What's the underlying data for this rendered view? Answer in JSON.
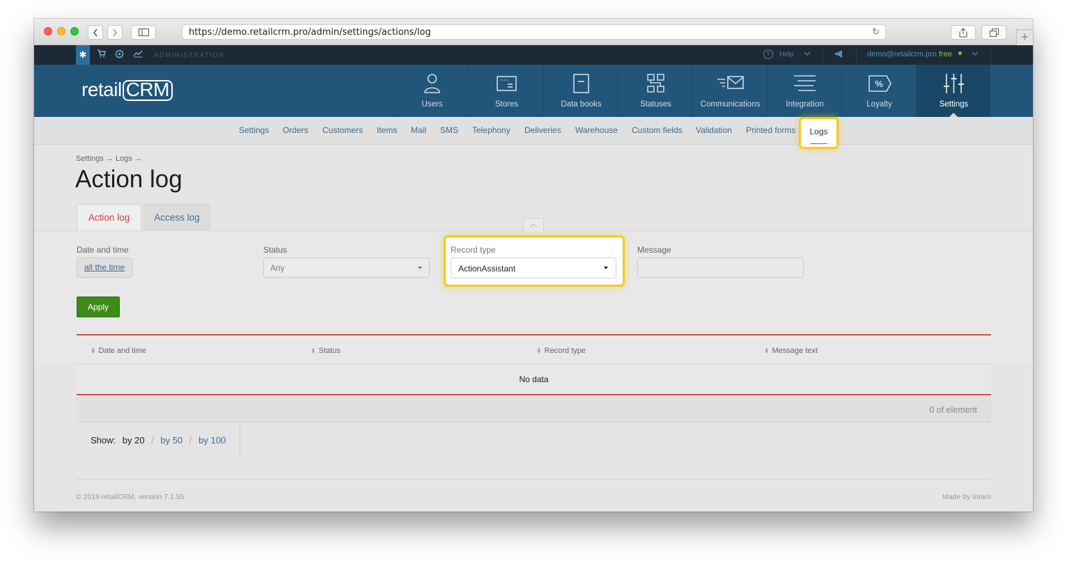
{
  "browser": {
    "url": "https://demo.retailcrm.pro/admin/settings/actions/log",
    "new_tab_glyph": "+",
    "reload_icon": "reload-icon"
  },
  "admin_bar": {
    "label": "ADMINISTRATION",
    "help": "Help",
    "email": "demo@retailcrm.pro",
    "plan": "free"
  },
  "logo": {
    "part1": "retail",
    "part2": "CRM"
  },
  "main_nav": [
    {
      "label": "Users",
      "icon": "user-icon"
    },
    {
      "label": "Stores",
      "icon": "store-icon"
    },
    {
      "label": "Data books",
      "icon": "book-icon"
    },
    {
      "label": "Statuses",
      "icon": "statuses-icon"
    },
    {
      "label": "Communications",
      "icon": "mail-icon"
    },
    {
      "label": "Integration",
      "icon": "integration-icon"
    },
    {
      "label": "Loyalty",
      "icon": "percent-tag-icon"
    },
    {
      "label": "Settings",
      "icon": "sliders-icon",
      "active": true
    }
  ],
  "sub_nav": [
    "Settings",
    "Orders",
    "Customers",
    "Items",
    "Mail",
    "SMS",
    "Telephony",
    "Deliveries",
    "Warehouse",
    "Custom fields",
    "Validation",
    "Printed forms",
    "Logs"
  ],
  "breadcrumb": "Settings → Logs →",
  "page_title": "Action log",
  "tabs": [
    "Action log",
    "Access log"
  ],
  "filters": {
    "date_label": "Date and time",
    "date_value": "all the time",
    "status_label": "Status",
    "status_value": "Any",
    "record_type_label": "Record type",
    "record_type_value": "ActionAssistant",
    "message_label": "Message",
    "message_value": "",
    "apply": "Apply"
  },
  "table": {
    "columns": [
      "Date and time",
      "Status",
      "Record type",
      "Message text"
    ],
    "empty_text": "No data"
  },
  "pagination": {
    "count_text": "0 of element",
    "show_label": "Show:",
    "options": [
      "by 20",
      "by 50",
      "by 100"
    ],
    "separator": "/"
  },
  "footer": {
    "copyright": "© 2019 retailCRM, version 7.1.55",
    "made_by": "Made by Intaro"
  },
  "colors": {
    "nav_bg": "#22557a",
    "highlight": "#f3cb1c",
    "apply_green": "#3e8a17",
    "accent_red": "#d84b4b"
  }
}
